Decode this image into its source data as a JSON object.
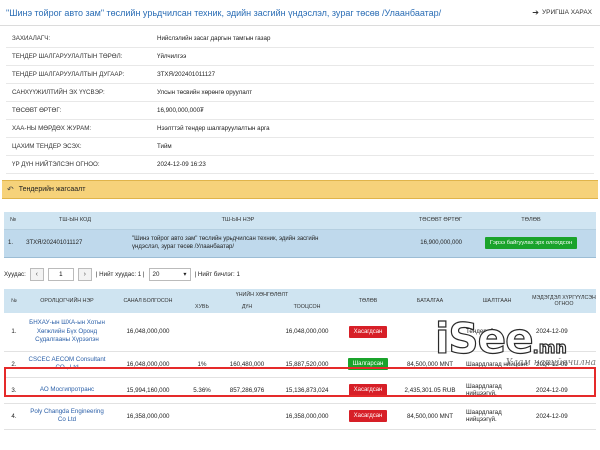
{
  "header": {
    "title": "\"Шинэ тойрог авто зам\" төслийн урьдчилсан техник, эдийн засгийн үндэслэл, зураг төсөв /Улаанбаатар/",
    "back_label": "УРИГША ХАРАХ",
    "back_icon": "arrow-left-icon"
  },
  "info": [
    {
      "label": "ЗАХИАЛАГЧ:",
      "value": "Нийслэлийн засаг даргын тамгын газар"
    },
    {
      "label": "ТЕНДЕР ШАЛГАРУУЛАЛТЫН ТӨРӨЛ:",
      "value": "Үйлчилгээ"
    },
    {
      "label": "ТЕНДЕР ШАЛГАРУУЛАЛТЫН ДУГААР:",
      "value": "ЗТХЯ/202401011127"
    },
    {
      "label": "САНХҮҮЖИЛТИЙН ЭХ ҮҮСВЭР:",
      "value": "Улсын төсвийн хөрөнгө оруулалт"
    },
    {
      "label": "ТӨСӨВТ ӨРТӨГ:",
      "value": "16,900,000,000₮"
    },
    {
      "label": "ХАА-НЫ МӨРДӨХ ЖУРАМ:",
      "value": "Нээлттэй тендер шалгаруулалтын арга"
    },
    {
      "label": "ЦАХИМ ТЕНДЕР ЭСЭХ:",
      "value": "Тийм"
    },
    {
      "label": "ҮР ДҮН НИЙТЭЛСЭН ОГНОО:",
      "value": "2024-12-09 16:23"
    }
  ],
  "section": {
    "label": "Тендерийн жагсаалт",
    "icon": "arrow-back-icon"
  },
  "tender_table": {
    "headers": {
      "no": "№",
      "code": "ТШ-ЫН КОД",
      "name": "ТШ-ЫН НЭР",
      "cost": "ТӨСӨВТ ӨРТӨГ",
      "status": "ТӨЛӨВ"
    },
    "row": {
      "no": "1.",
      "code": "ЗТХЯ/202401011127",
      "name": "\"Шинэ тойрог авто зам\" төслийн урьдчилсан техник, эдийн засгийн үндэслэл, зураг төсөв /Улаанбаатар/",
      "cost": "16,900,000,000",
      "status": "Гэрээ байгуулах эрх олгогдсон"
    }
  },
  "pager": {
    "label_page": "Хуудас:",
    "page_value": "1",
    "label_total_pages": "| Нийт хуудас: 1 |",
    "per_page": "20",
    "label_total_records": "| Нийт бичлэг: 1"
  },
  "bids": {
    "headers": {
      "no": "№",
      "org": "ОРОЛЦОГЧИЙН НЭР",
      "offered": "САНАЛ БОЛГОСОН",
      "discount_group": "ҮНИЙН ХӨНГӨЛӨЛТ",
      "pct": "ХУВЬ",
      "amount": "ДҮН",
      "total": "ТООЦСОН",
      "status": "ТӨЛӨВ",
      "guarantee": "БАТАЛГАА",
      "reason": "ШАЛТГААН",
      "date": "МЭДЭГДЭЛ ХҮРГҮҮЛСЭН ОГНОО"
    },
    "rows": [
      {
        "no": "1.",
        "org": "БНХАУ-ын ШХА-ын Хотын Хөгжлийн Бүх Оронд Судалгааны Хүрээлэн",
        "offered": "16,048,000,000",
        "pct": "",
        "amount": "",
        "total": "16,048,000,000",
        "status": "Хасагдсан",
        "status_type": "rejected",
        "guarantee": "",
        "reason": "Тендерийн",
        "date": "2024-12-09"
      },
      {
        "no": "2.",
        "org": "CSCEC AECOM Consultant CO., Ltd",
        "offered": "16,048,000,000",
        "pct": "1%",
        "amount": "160,480,000",
        "total": "15,887,520,000",
        "status": "Шалгарсан",
        "status_type": "selected",
        "guarantee": "84,500,000 MNT",
        "reason": "Шаардлагад нийцсэн.",
        "date": "2024-12-09"
      },
      {
        "no": "3.",
        "org": "АО Мосгипротранс",
        "offered": "15,994,160,000",
        "pct": "5.36%",
        "amount": "857,286,976",
        "total": "15,136,873,024",
        "status": "Хасагдсан",
        "status_type": "rejected",
        "guarantee": "2,435,301.05 RUB",
        "reason": "Шаардлагад нийцээгүй.",
        "date": "2024-12-09"
      },
      {
        "no": "4.",
        "org": "Poly Changda Engineering Co Ltd",
        "offered": "16,358,000,000",
        "pct": "",
        "amount": "",
        "total": "16,358,000,000",
        "status": "Хасагдсан",
        "status_type": "rejected",
        "guarantee": "84,500,000 MNT",
        "reason": "Шаардлагад нийцээгүй.",
        "date": "2024-12-09"
      }
    ]
  },
  "watermark": {
    "logo": "iSee",
    "tld": ".mn",
    "signature": "Улам нарийвчилна"
  }
}
